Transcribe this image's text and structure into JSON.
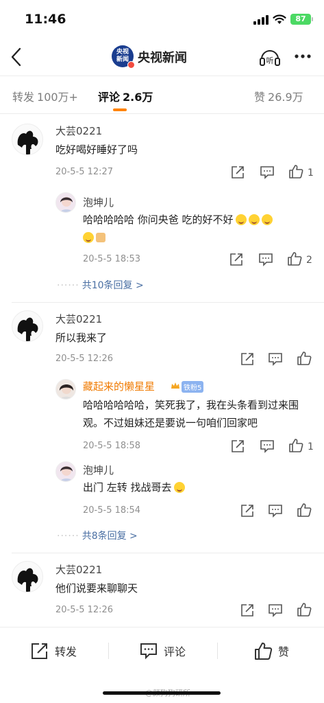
{
  "status_bar": {
    "time": "11:46",
    "battery": "87"
  },
  "header": {
    "title": "央视新闻",
    "logo_text": "央视\n新闻",
    "listen_label": "听"
  },
  "tabs": [
    {
      "label": "转发",
      "count": "100万+"
    },
    {
      "label": "评论",
      "count": "2.6万"
    },
    {
      "label": "赞",
      "count": "26.9万"
    }
  ],
  "comments": [
    {
      "user": "大芸0221",
      "text": "吃好喝好睡好了吗",
      "time": "20-5-5 12:27",
      "likes": "1",
      "replies": [
        {
          "user": "泡坤儿",
          "text": "哈哈哈哈哈 你问央爸 吃的好不好",
          "time": "20-5-5 18:53",
          "likes": "2"
        }
      ],
      "more_replies": "共10条回复 >"
    },
    {
      "user": "大芸0221",
      "text": "所以我来了",
      "time": "20-5-5 12:26",
      "likes": "",
      "replies": [
        {
          "user": "藏起来的懒星星",
          "badge": "铁粉5",
          "text": "哈哈哈哈哈哈，笑死我了，我在头条看到过来围观。不过姐妹还是要说一句咱们回家吧",
          "time": "20-5-5 18:58",
          "likes": "1"
        },
        {
          "user": "泡坤儿",
          "text": "出门 左转 找战哥去",
          "time": "20-5-5 18:54",
          "likes": ""
        }
      ],
      "more_replies": "共8条回复 >"
    },
    {
      "user": "大芸0221",
      "text": "他们说要来聊聊天",
      "time": "20-5-5 12:26",
      "likes": "",
      "replies": []
    }
  ],
  "bottom_bar": {
    "repost": "转发",
    "comment": "评论",
    "like": "赞"
  },
  "watermark": "@颜狗狗研所",
  "colors": {
    "accent": "#ff8200",
    "link": "#4a6fa3",
    "orange_name": "#f07a00"
  }
}
